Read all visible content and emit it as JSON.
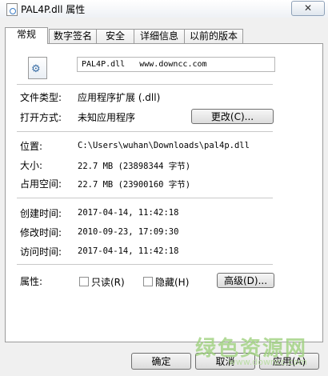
{
  "window": {
    "title": "PAL4P.dll 属性",
    "close_glyph": "✕"
  },
  "tabs": [
    {
      "label": "常规"
    },
    {
      "label": "数字签名"
    },
    {
      "label": "安全"
    },
    {
      "label": "详细信息"
    },
    {
      "label": "以前的版本"
    }
  ],
  "general": {
    "file_name": "PAL4P.dll   www.downcc.com",
    "file_type_label": "文件类型:",
    "file_type_value": "应用程序扩展 (.dll)",
    "open_with_label": "打开方式:",
    "open_with_value": "未知应用程序",
    "change_button": "更改(C)...",
    "location_label": "位置:",
    "location_value": "C:\\Users\\wuhan\\Downloads\\pal4p.dll",
    "size_label": "大小:",
    "size_value": "22.7 MB (23898344 字节)",
    "size_on_disk_label": "占用空间:",
    "size_on_disk_value": "22.7 MB (23900160 字节)",
    "created_label": "创建时间:",
    "created_value": "2017-04-14, 11:42:18",
    "modified_label": "修改时间:",
    "modified_value": "2010-09-23, 17:09:30",
    "accessed_label": "访问时间:",
    "accessed_value": "2017-04-14, 11:42:18",
    "attributes_label": "属性:",
    "readonly_label": "只读(R)",
    "readonly_checked": false,
    "hidden_label": "隐藏(H)",
    "hidden_checked": false,
    "advanced_button": "高级(D)..."
  },
  "footer": {
    "ok_button": "确定",
    "cancel_button": "取消",
    "apply_button": "应用(A)"
  },
  "watermark": {
    "text": "绿色资源网",
    "url": "www.downcc.com"
  }
}
